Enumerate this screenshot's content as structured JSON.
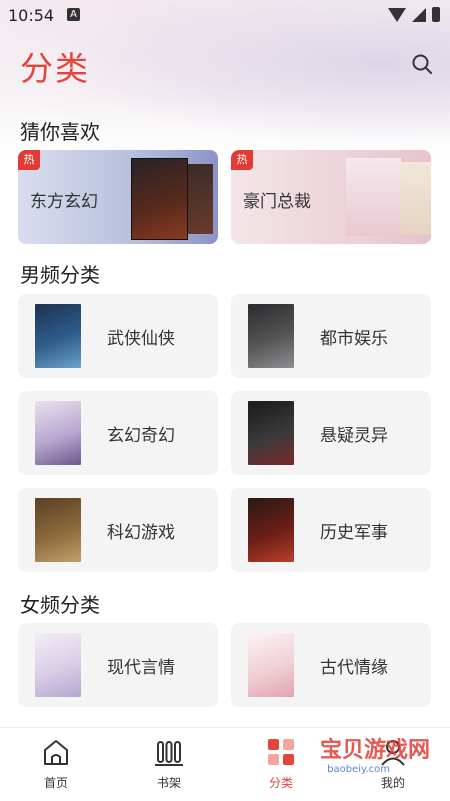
{
  "status": {
    "time": "10:54",
    "a_badge": "A"
  },
  "header": {
    "title": "分类"
  },
  "sections": {
    "guess": "猜你喜欢",
    "male": "男频分类",
    "female": "女频分类"
  },
  "guess_cards": [
    {
      "label": "东方玄幻",
      "badge": "热"
    },
    {
      "label": "豪门总裁",
      "badge": "热"
    }
  ],
  "male_categories": [
    {
      "label": "武侠仙侠"
    },
    {
      "label": "都市娱乐"
    },
    {
      "label": "玄幻奇幻"
    },
    {
      "label": "悬疑灵异"
    },
    {
      "label": "科幻游戏"
    },
    {
      "label": "历史军事"
    }
  ],
  "female_categories": [
    {
      "label": "现代言情"
    },
    {
      "label": "古代情缘"
    }
  ],
  "nav": [
    {
      "label": "首页",
      "icon": "home-icon"
    },
    {
      "label": "书架",
      "icon": "bookshelf-icon"
    },
    {
      "label": "分类",
      "icon": "category-icon",
      "active": true
    },
    {
      "label": "我的",
      "icon": "profile-icon"
    }
  ],
  "watermark": {
    "text": "宝贝游戏网",
    "sub": "baobeiy.com"
  },
  "colors": {
    "accent": "#e2453c",
    "card_bg": "#f4f4f4"
  }
}
